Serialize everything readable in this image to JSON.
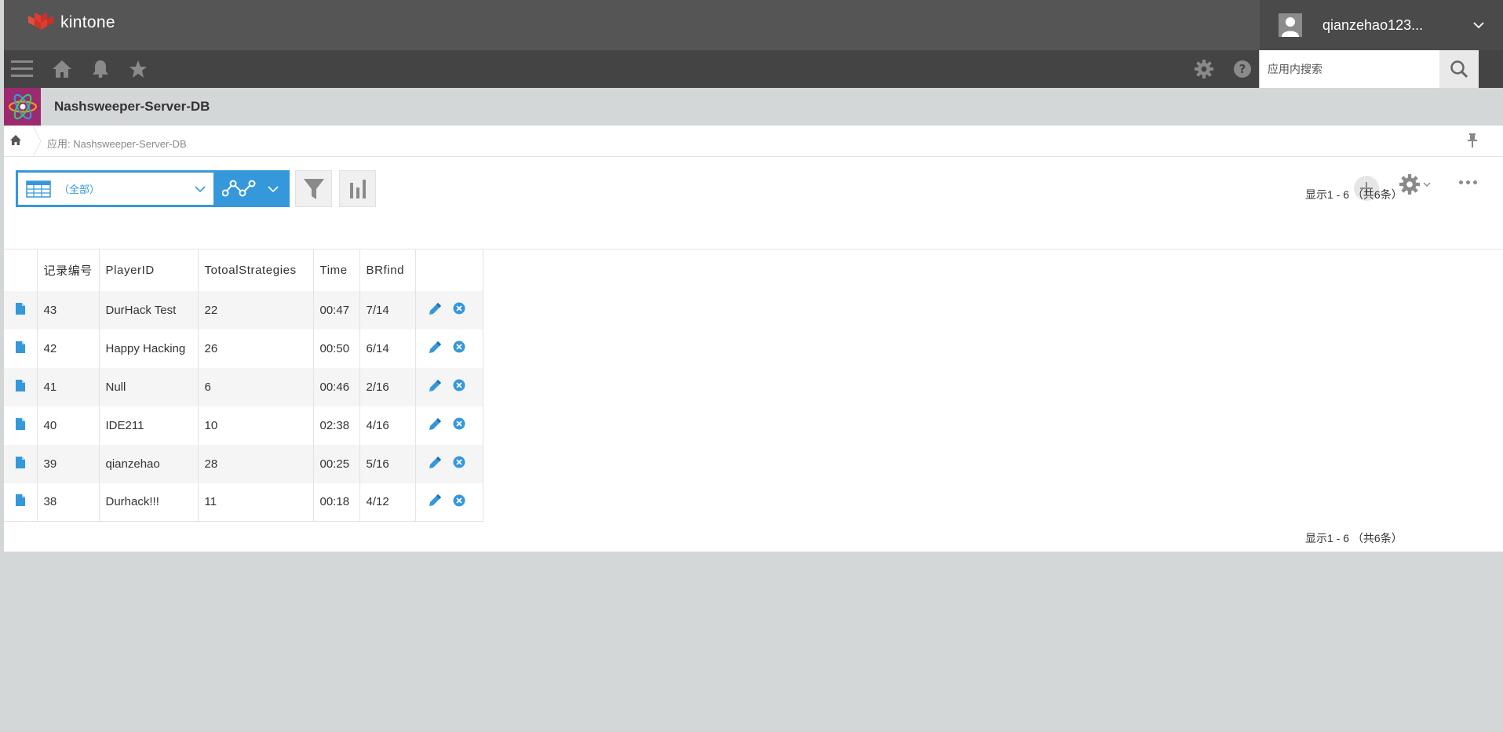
{
  "header": {
    "brand": "kintone",
    "username": "qianzehao123..."
  },
  "navbar": {
    "search_placeholder": "应用内搜索"
  },
  "app": {
    "title": "Nashsweeper-Server-DB"
  },
  "breadcrumb": {
    "text": "应用: Nashsweeper-Server-DB"
  },
  "toolbar": {
    "view_label": "（全部）"
  },
  "pager": {
    "top": "显示1 - 6 （共6条）",
    "bottom": "显示1 - 6 （共6条）"
  },
  "table": {
    "headers": [
      "记录编号",
      "PlayerID",
      "TotoalStrategies",
      "Time",
      "BRfind"
    ],
    "rows": [
      {
        "id": "43",
        "player": "DurHack Test",
        "strategies": "22",
        "time": "00:47",
        "brfind": "7/14"
      },
      {
        "id": "42",
        "player": "Happy Hacking",
        "strategies": "26",
        "time": "00:50",
        "brfind": "6/14"
      },
      {
        "id": "41",
        "player": "Null",
        "strategies": "6",
        "time": "00:46",
        "brfind": "2/16"
      },
      {
        "id": "40",
        "player": "IDE211",
        "strategies": "10",
        "time": "02:38",
        "brfind": "4/16"
      },
      {
        "id": "39",
        "player": "qianzehao",
        "strategies": "28",
        "time": "00:25",
        "brfind": "5/16"
      },
      {
        "id": "38",
        "player": "Durhack!!!",
        "strategies": "11",
        "time": "00:18",
        "brfind": "4/12"
      }
    ]
  },
  "colors": {
    "accent": "#3498db",
    "header_bg": "#555555",
    "navbar_bg": "#444444",
    "app_icon_bg": "#9b2a6e"
  }
}
